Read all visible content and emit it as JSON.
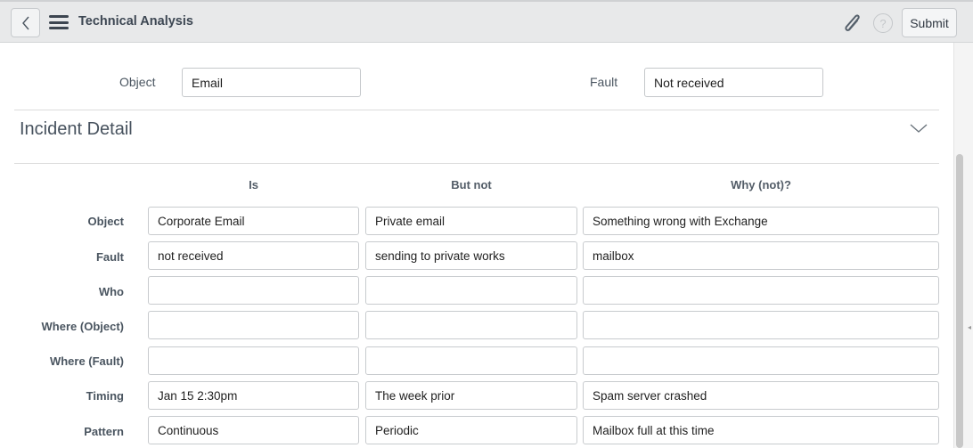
{
  "header": {
    "title": "Technical Analysis",
    "submit_label": "Submit",
    "help_glyph": "?"
  },
  "top_fields": {
    "object": {
      "label": "Object",
      "value": "Email"
    },
    "fault": {
      "label": "Fault",
      "value": "Not received"
    }
  },
  "section": {
    "title": "Incident Detail"
  },
  "table": {
    "columns": [
      "Is",
      "But not",
      "Why (not)?"
    ],
    "rows": [
      {
        "label": "Object",
        "is": "Corporate Email",
        "but_not": "Private email",
        "why": "Something wrong with Exchange"
      },
      {
        "label": "Fault",
        "is": "not received",
        "but_not": "sending to private works",
        "why": "mailbox"
      },
      {
        "label": "Who",
        "is": "",
        "but_not": "",
        "why": ""
      },
      {
        "label": "Where (Object)",
        "is": "",
        "but_not": "",
        "why": ""
      },
      {
        "label": "Where (Fault)",
        "is": "",
        "but_not": "",
        "why": ""
      },
      {
        "label": "Timing",
        "is": "Jan 15 2:30pm",
        "but_not": "The week prior",
        "why": "Spam server crashed"
      },
      {
        "label": "Pattern",
        "is": "Continuous",
        "but_not": "Periodic",
        "why": "Mailbox full at this time"
      }
    ]
  }
}
